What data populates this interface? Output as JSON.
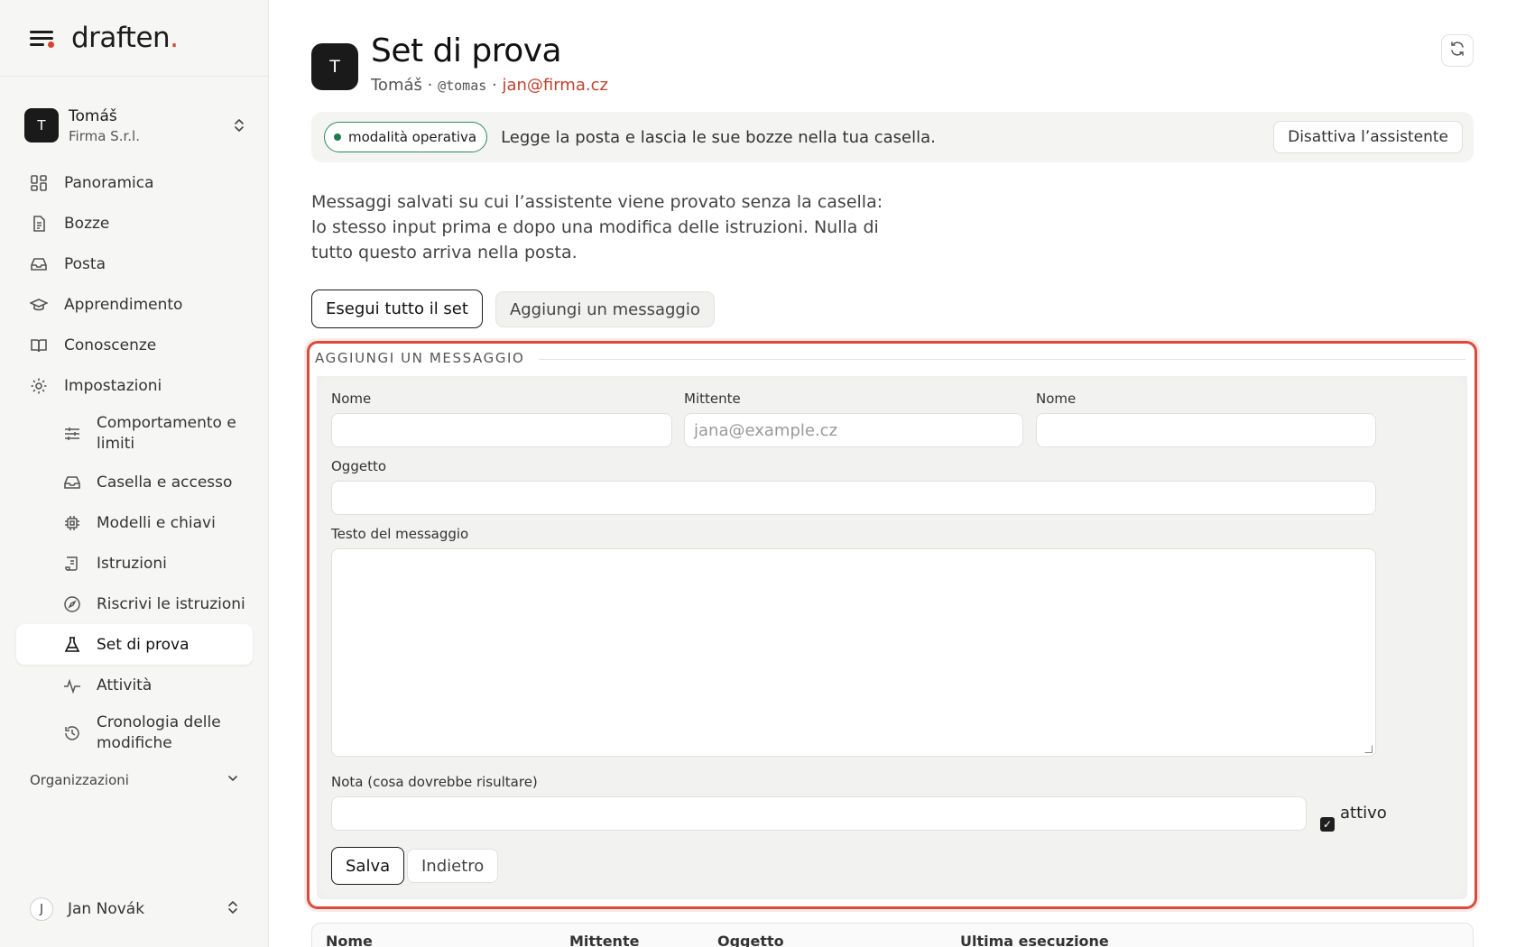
{
  "brand": {
    "name": "draften",
    "dot": "."
  },
  "account": {
    "initial": "T",
    "name": "Tomáš",
    "org": "Firma S.r.l."
  },
  "nav": {
    "items": [
      {
        "label": "Panoramica",
        "icon": "grid-icon"
      },
      {
        "label": "Bozze",
        "icon": "document-icon"
      },
      {
        "label": "Posta",
        "icon": "inbox-icon"
      },
      {
        "label": "Apprendimento",
        "icon": "graduation-cap-icon"
      },
      {
        "label": "Conoscenze",
        "icon": "book-icon"
      },
      {
        "label": "Impostazioni",
        "icon": "gear-icon"
      }
    ],
    "sub_items": [
      {
        "label": "Comportamento e limiti",
        "icon": "sliders-icon"
      },
      {
        "label": "Casella e accesso",
        "icon": "inbox-icon"
      },
      {
        "label": "Modelli e chiavi",
        "icon": "chip-icon"
      },
      {
        "label": "Istruzioni",
        "icon": "scroll-icon"
      },
      {
        "label": "Riscrivi le istruzioni",
        "icon": "compass-icon"
      },
      {
        "label": "Set di prova",
        "icon": "flask-icon",
        "active": true
      },
      {
        "label": "Attività",
        "icon": "activity-icon"
      },
      {
        "label": "Cronologia delle modifiche",
        "icon": "history-icon"
      }
    ],
    "organizations_label": "Organizzazioni"
  },
  "user": {
    "initial": "J",
    "name": "Jan Novák"
  },
  "header": {
    "initial": "T",
    "title": "Set di prova",
    "owner": "Tomáš",
    "sep1": " · ",
    "handle": "@tomas",
    "sep2": " · ",
    "email": "jan@firma.cz"
  },
  "status": {
    "pill": "modalità operativa",
    "description": "Legge la posta e lascia le sue bozze nella tua casella.",
    "disable_button": "Disattiva l’assistente"
  },
  "intro": "Messaggi salvati su cui l’assistente viene provato senza la casella: lo stesso input prima e dopo una modifica delle istruzioni. Nulla di tutto questo arriva nella posta.",
  "actions": {
    "run_all": "Esegui tutto il set",
    "add_message": "Aggiungi un messaggio"
  },
  "form": {
    "legend": "AGGIUNGI UN MESSAGGIO",
    "name_label": "Nome",
    "name_value": "",
    "sender_label": "Mittente",
    "sender_placeholder": "jana@example.cz",
    "sender_name_label": "Nome",
    "sender_name_value": "",
    "subject_label": "Oggetto",
    "subject_value": "",
    "body_label": "Testo del messaggio",
    "body_value": "",
    "note_label": "Nota (cosa dovrebbe risultare)",
    "note_value": "",
    "active_label": "attivo",
    "active_checked": true,
    "save_button": "Salva",
    "back_button": "Indietro"
  },
  "table": {
    "columns": [
      "Nome",
      "Mittente",
      "Oggetto",
      "Ultima esecuzione"
    ]
  },
  "colors": {
    "accent": "#d6442e",
    "highlight_border": "#db4a3a",
    "status_green": "#1f7a4d"
  }
}
